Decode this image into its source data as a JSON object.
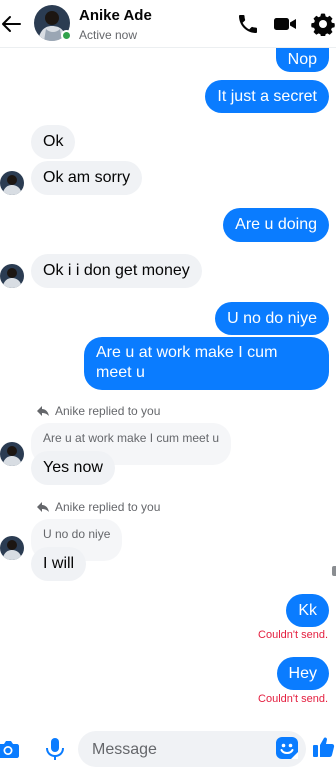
{
  "header": {
    "contact_name": "Anike Ade",
    "status": "Active now",
    "icons": [
      "back-arrow-icon",
      "phone-icon",
      "video-camera-icon",
      "gear-icon"
    ]
  },
  "messages": [
    {
      "side": "out",
      "text": "Nop"
    },
    {
      "side": "out",
      "text": "It just a secret"
    },
    {
      "side": "in",
      "text": "Ok"
    },
    {
      "side": "in",
      "text": "Ok am sorry"
    },
    {
      "side": "out",
      "text": "Are u doing"
    },
    {
      "side": "in",
      "text": "Ok i i don get money"
    },
    {
      "side": "out",
      "text": "U no do niye"
    },
    {
      "side": "out",
      "text": "Are u at work make I cum meet u"
    },
    {
      "side": "in",
      "reply_label": "Anike replied to you",
      "quoted": "Are u at work make I cum meet u",
      "text": "Yes now"
    },
    {
      "side": "in",
      "reply_label": "Anike replied to you",
      "quoted": "U no do niye",
      "text": "I will"
    },
    {
      "side": "out",
      "text": "Kk",
      "error": "Couldn't send."
    },
    {
      "side": "out",
      "text": "Hey",
      "error": "Couldn't send."
    }
  ],
  "composer": {
    "placeholder": "Message",
    "icons": [
      "camera-icon",
      "microphone-icon",
      "emoji-icon",
      "thumbs-up-icon"
    ]
  },
  "colors": {
    "accent": "#0a7cff",
    "incoming_bubble": "#f0f2f5",
    "error": "#e41e3f",
    "online": "#31a24c"
  }
}
